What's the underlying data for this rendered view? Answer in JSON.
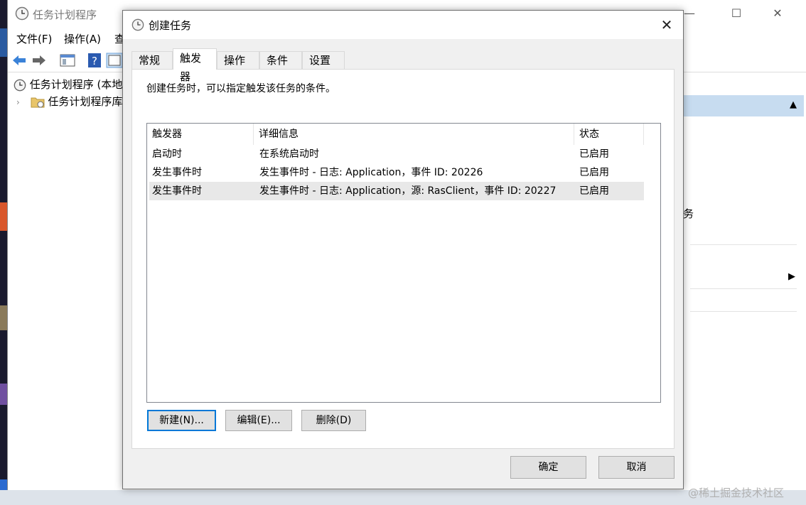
{
  "background_app": {
    "title": "任务计划程序",
    "menu": [
      "文件(F)",
      "操作(A)",
      "查"
    ],
    "tree": {
      "root_label": "任务计划程序 (本地",
      "child_label": "任务计划程序库"
    },
    "right_panel": {
      "partial_text": "务",
      "arrow": "▶",
      "collapse": "▲"
    },
    "window_controls": {
      "minimize": "—",
      "maximize": "☐",
      "close": "✕"
    }
  },
  "dialog": {
    "title": "创建任务",
    "close_glyph": "✕",
    "tabs": [
      {
        "label": "常规",
        "active": false
      },
      {
        "label": "触发器",
        "active": true
      },
      {
        "label": "操作",
        "active": false
      },
      {
        "label": "条件",
        "active": false
      },
      {
        "label": "设置",
        "active": false
      }
    ],
    "description": "创建任务时，可以指定触发该任务的条件。",
    "list": {
      "columns": [
        "触发器",
        "详细信息",
        "状态"
      ],
      "rows": [
        {
          "trigger": "启动时",
          "details": "在系统启动时",
          "status": "已启用",
          "selected": false
        },
        {
          "trigger": "发生事件时",
          "details": "发生事件时 - 日志: Application，事件 ID: 20226",
          "status": "已启用",
          "selected": false
        },
        {
          "trigger": "发生事件时",
          "details": "发生事件时 - 日志: Application，源: RasClient，事件 ID: 20227",
          "status": "已启用",
          "selected": true
        }
      ]
    },
    "buttons": {
      "new_label": "新建(N)...",
      "edit_label": "编辑(E)...",
      "delete_label": "删除(D)",
      "ok_label": "确定",
      "cancel_label": "取消"
    }
  },
  "watermark": "@稀土掘金技术社区",
  "colors": {
    "accent": "#0078d7",
    "selected_row": "#e8e8e8",
    "panel_band": "#c7dcf0"
  }
}
